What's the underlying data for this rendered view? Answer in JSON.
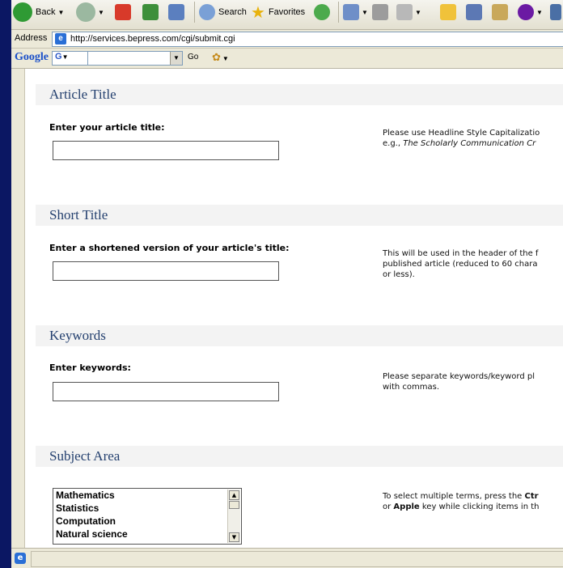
{
  "toolbar": {
    "back_label": "Back",
    "search_label": "Search",
    "favorites_label": "Favorites"
  },
  "address": {
    "label": "Address",
    "url": "http://services.bepress.com/cgi/submit.cgi"
  },
  "google": {
    "logo": "Google",
    "selector": "G",
    "go_label": "Go"
  },
  "sections": {
    "title": {
      "heading": "Article Title",
      "label": "Enter your article title:",
      "help_line1": "Please use Headline Style Capitalizatio",
      "help_line2_prefix": "e.g., ",
      "help_line2_italic": "The Scholarly Communication Cr"
    },
    "short": {
      "heading": "Short Title",
      "label": "Enter a shortened version of your article's title:",
      "help_line1": "This will be used in the header of the f",
      "help_line2": "published article (reduced to 60 chara",
      "help_line3": "or less)."
    },
    "keywords": {
      "heading": "Keywords",
      "label": "Enter keywords:",
      "help_line1": "Please separate keywords/keyword pl",
      "help_line2": "with commas."
    },
    "subject": {
      "heading": "Subject Area",
      "options": [
        "Mathematics",
        "Statistics",
        "Computation",
        "Natural science"
      ],
      "help_line1_prefix": "To select multiple terms, press the ",
      "help_line1_bold": "Ctr",
      "help_line2_prefix": "or ",
      "help_line2_bold": "Apple",
      "help_line2_suffix": " key while clicking items in th"
    }
  }
}
